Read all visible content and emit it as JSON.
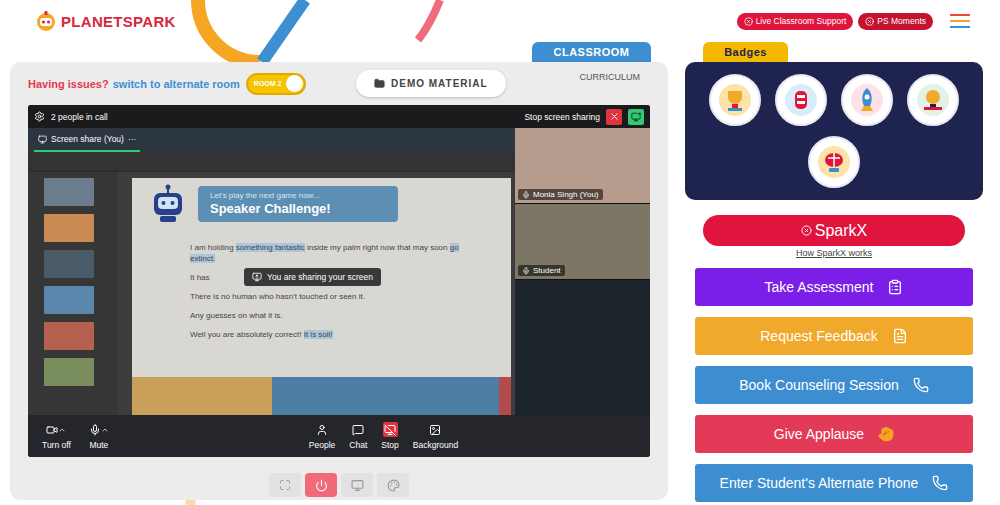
{
  "header": {
    "logo": "PLANETSPARK",
    "support": "Live Classroom Support",
    "moments": "PS Moments"
  },
  "classroom": {
    "tab": "CLASSROOM",
    "curriculum": "CURRICULUM",
    "issues": "Having issues?",
    "switch_link": "switch to alternate room",
    "room_toggle": {
      "label": "ROOM 2",
      "on": true
    },
    "demo_material": "DEMO MATERIAL"
  },
  "call": {
    "people": "2 people in call",
    "stop_sharing": "Stop screen sharing",
    "share_tab": {
      "label": "Screen share (You)",
      "menu": "···",
      "selected": true
    },
    "sharing_notice": "You are sharing your screen",
    "participants": [
      {
        "name": "Monia Singh (You)"
      },
      {
        "name": "Student"
      }
    ],
    "controls": [
      {
        "label": "Turn off",
        "alert": false
      },
      {
        "label": "Mute",
        "alert": false
      },
      {
        "label": "People",
        "alert": false
      },
      {
        "label": "Chat",
        "alert": false
      },
      {
        "label": "Stop",
        "alert": true
      },
      {
        "label": "Background",
        "alert": false
      }
    ]
  },
  "slide": {
    "intro": "Let's play the next game now...",
    "title": "Speaker Challenge!",
    "lines": [
      [
        {
          "text": "I am holding ",
          "highlight": false
        },
        {
          "text": "something fantastic",
          "highlight": true
        },
        {
          "text": " inside my palm right now that may soon ",
          "highlight": false
        },
        {
          "text": "go extinct.",
          "highlight": true
        }
      ],
      [
        {
          "text": "It has",
          "highlight": false
        }
      ],
      [
        {
          "text": "There is no human who hasn't touched or seen it.",
          "highlight": false
        }
      ],
      [
        {
          "text": "Any guesses on what it is.",
          "highlight": false
        }
      ],
      [
        {
          "text": "Well you are absolutely correct! ",
          "highlight": false
        },
        {
          "text": "It is soil!",
          "highlight": true
        }
      ]
    ]
  },
  "sidebar": {
    "badges_tab": "Badges",
    "sparkx": "SparkX",
    "sparkx_link": "How SparkX works",
    "actions": [
      {
        "label": "Take Assessment",
        "color": "#7b1fe8"
      },
      {
        "label": "Request Feedback",
        "color": "#f0a92a"
      },
      {
        "label": "Book Counseling Session",
        "color": "#3d8dd1"
      },
      {
        "label": "Give Applause",
        "color": "#e23a57"
      },
      {
        "label": "Enter Student's Alternate Phone",
        "color": "#3d8dd1"
      }
    ]
  }
}
